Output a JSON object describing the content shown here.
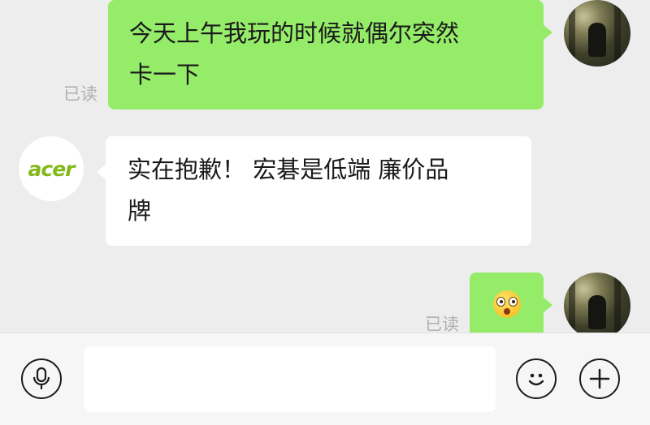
{
  "messages": [
    {
      "side": "out",
      "text_line1": "今天上午我玩的时候就偶尔突然",
      "text_line2": "卡一下",
      "status": "已读"
    },
    {
      "side": "in",
      "avatar_text": "acer",
      "text_line1": "实在抱歉！ 宏碁是低端 廉价品",
      "text_line2": "牌"
    },
    {
      "side": "out",
      "emoji": "flushed-face",
      "status": "已读"
    }
  ],
  "colors": {
    "outgoing_bubble": "#95ec69",
    "incoming_bubble": "#ffffff",
    "acer_green": "#83b81a",
    "background": "#ededed"
  },
  "input_bar": {
    "voice_icon": "microphone-icon",
    "emoji_icon": "smiley-icon",
    "more_icon": "plus-icon",
    "text_value": ""
  }
}
